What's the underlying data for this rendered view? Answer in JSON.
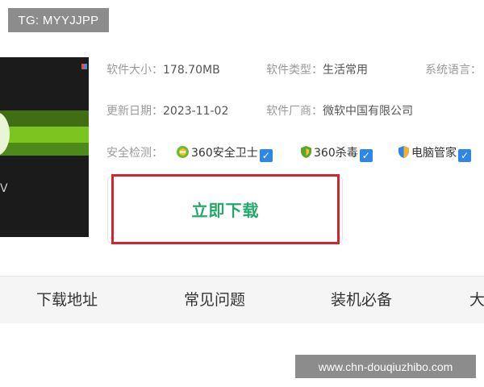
{
  "watermark_top": "TG: MYYJJPP",
  "watermark_bottom": "www.chn-douqiuzhibo.com",
  "thumbnail": {
    "partial_text": "V"
  },
  "info": {
    "size_label": "软件大小：",
    "size_value": "178.70MB",
    "type_label": "软件类型：",
    "type_value": "生活常用",
    "lang_label": "系统语言：",
    "date_label": "更新日期：",
    "date_value": "2023-11-02",
    "vendor_label": "软件厂商：",
    "vendor_value": "微软中国有限公司",
    "security_label": "安全检测：",
    "security_items": [
      {
        "name": "360安全卫士",
        "icon": "360-safeguard-icon",
        "checked": true
      },
      {
        "name": "360杀毒",
        "icon": "360-antivirus-icon",
        "checked": true
      },
      {
        "name": "电脑管家",
        "icon": "pc-manager-icon",
        "checked": true
      }
    ]
  },
  "download_button": {
    "label": "立即下载",
    "highlight_color": "#d2252f",
    "text_color": "#25a86a"
  },
  "tabs": [
    {
      "label": "下载地址"
    },
    {
      "label": "常见问题"
    },
    {
      "label": "装机必备"
    },
    {
      "label": "大"
    }
  ],
  "check_mark": "✓",
  "colors": {
    "check_blue": "#2f86e6",
    "tab_bar_bg": "#f5f5f5"
  }
}
